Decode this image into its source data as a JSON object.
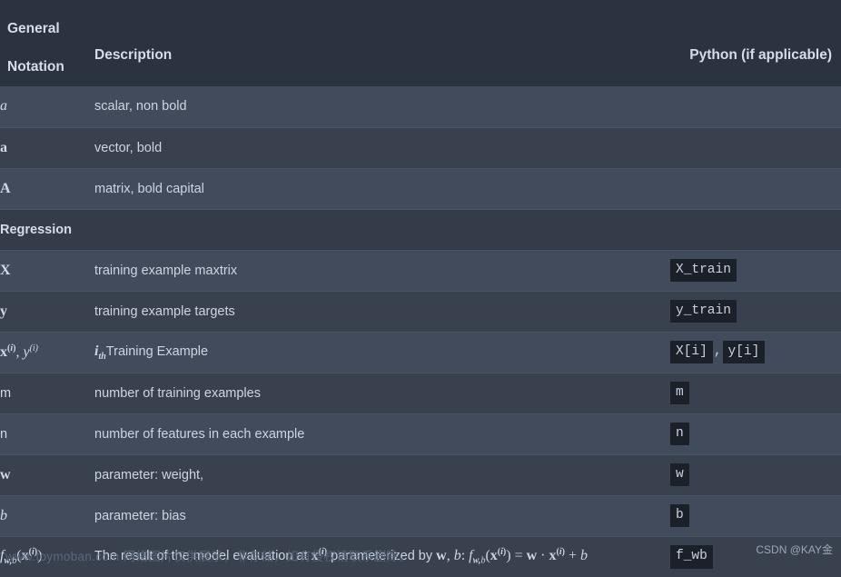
{
  "header": {
    "general_label": "General",
    "notation_label": "Notation",
    "description_label": "Description",
    "python_label": "Python (if applicable)"
  },
  "sections": {
    "regression_label": "Regression"
  },
  "rows": [
    {
      "notation": "a",
      "description": "scalar, non bold",
      "python": ""
    },
    {
      "notation": "a",
      "description": "vector, bold",
      "python": ""
    },
    {
      "notation": "A",
      "description": "matrix, bold capital",
      "python": ""
    },
    {
      "notation": "X",
      "description": "training example maxtrix",
      "python": "X_train"
    },
    {
      "notation": "y",
      "description": "training example targets",
      "python": "y_train"
    },
    {
      "notation": "x(i), y(i)",
      "description": "Training Example",
      "python_a": "X[i]",
      "python_b": "y[i]",
      "python_sep": ","
    },
    {
      "notation": "m",
      "description": "number of training examples",
      "python": "m"
    },
    {
      "notation": "n",
      "description": "number of features in each example",
      "python": "n"
    },
    {
      "notation": "w",
      "description": "parameter: weight,",
      "python": "w"
    },
    {
      "notation": "b",
      "description": "parameter: bias",
      "python": "b"
    },
    {
      "notation": "f_w,b(x(i))",
      "description": "The result of the model evaluation at x(i) parameterized by w, b: f_w,b(x(i)) = w · x(i) + b",
      "python": "f_wb"
    }
  ],
  "row_labels": {
    "ith_prefix": "i",
    "ith_sub": "th",
    "training_example": "Training Example",
    "formula_lead": "The result of the model evaluation at",
    "formula_mid": "parameterized by",
    "formula_wb": "w, b:",
    "formula_eq": "=",
    "formula_dot": "·",
    "formula_plus": "+"
  },
  "watermarks": {
    "bottom": "www.toymoban.com 网络图片仅供展示，非存储，如有侵权请联系删除。",
    "corner": "CSDN @KAY金"
  },
  "colors": {
    "header_bg": "#2b3240",
    "row_odd": "#414b5c",
    "row_even": "#39414f",
    "section_bg": "#343b49",
    "code_bg": "#1c2028",
    "text": "#cdd5e1"
  }
}
